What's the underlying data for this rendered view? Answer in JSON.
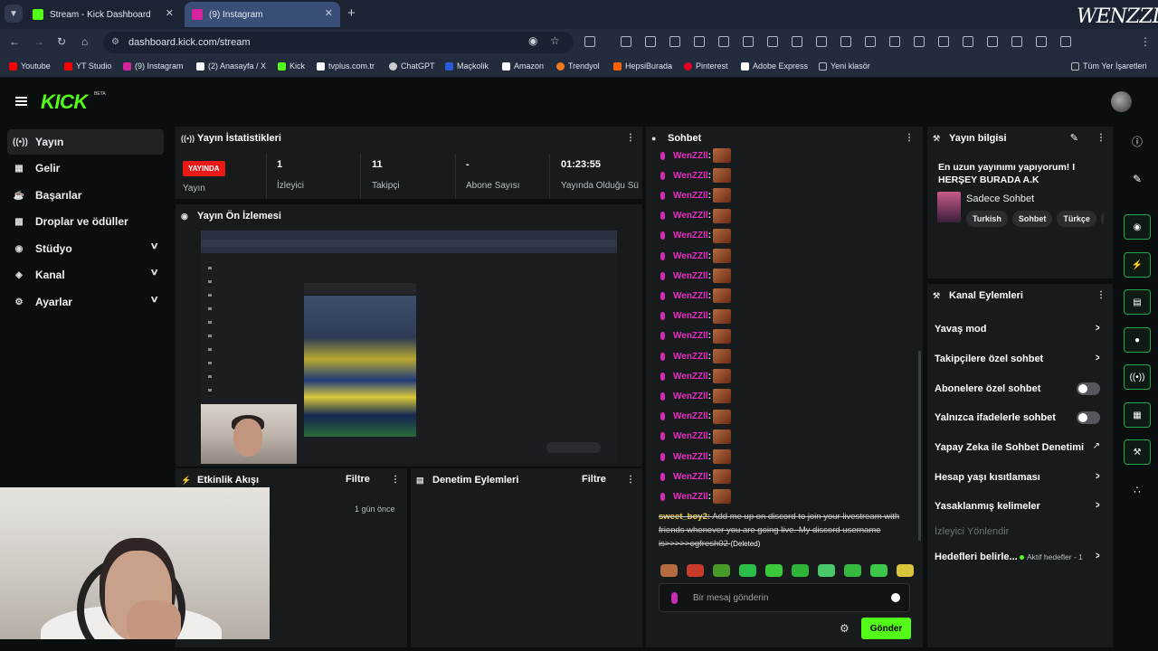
{
  "browser": {
    "tabs": [
      {
        "title": "Stream - Kick Dashboard",
        "favicon_color": "#53fc18"
      },
      {
        "title": "(9) Instagram",
        "favicon_color": "#d6249f"
      }
    ],
    "url": "dashboard.kick.com/stream",
    "bookmarks": [
      {
        "label": "Youtube",
        "color": "#ff0000"
      },
      {
        "label": "YT Studio",
        "color": "#ff0000"
      },
      {
        "label": "(9) Instagram",
        "color": "#d6249f"
      },
      {
        "label": "(2) Anasayfa / X",
        "color": "#ffffff"
      },
      {
        "label": "Kick",
        "color": "#53fc18"
      },
      {
        "label": "tvplus.com.tr",
        "color": "#ffffff"
      },
      {
        "label": "ChatGPT",
        "color": "#cccccc"
      },
      {
        "label": "Maçkolik",
        "color": "#2a5bd7"
      },
      {
        "label": "Amazon",
        "color": "#ffffff"
      },
      {
        "label": "Trendyol",
        "color": "#f27a1a"
      },
      {
        "label": "HepsiBurada",
        "color": "#ff6000"
      },
      {
        "label": "Pinterest",
        "color": "#e60023"
      },
      {
        "label": "Adobe Express",
        "color": "#ffffff"
      },
      {
        "label": "Yeni klasör",
        "color": "#bbbbbb"
      }
    ],
    "all_bookmarks": "Tüm Yer İşaretleri"
  },
  "brand": {
    "logo": "KICK",
    "beta": "BETA"
  },
  "sidebar": {
    "items": [
      {
        "label": "Yayın",
        "icon": "broadcast-icon"
      },
      {
        "label": "Gelir",
        "icon": "revenue-icon"
      },
      {
        "label": "Başarılar",
        "icon": "trophy-icon"
      },
      {
        "label": "Droplar ve ödüller",
        "icon": "gift-icon"
      },
      {
        "label": "Stüdyo",
        "icon": "eye-icon"
      },
      {
        "label": "Kanal",
        "icon": "channel-icon"
      },
      {
        "label": "Ayarlar",
        "icon": "gear-icon"
      }
    ]
  },
  "stats": {
    "title": "Yayın İstatistikleri",
    "live_badge": "YAYINDA",
    "items": [
      {
        "value": "",
        "label": "Yayın"
      },
      {
        "value": "1",
        "label": "İzleyici"
      },
      {
        "value": "11",
        "label": "Takipçi"
      },
      {
        "value": "-",
        "label": "Abone Sayısı"
      },
      {
        "value": "01:23:55",
        "label": "Yayında Olduğu Sü"
      }
    ]
  },
  "preview": {
    "title": "Yayın Ön İzlemesi"
  },
  "activity": {
    "title": "Etkinlik Akışı",
    "filter": "Filtre",
    "entry_time": "1 gün önce"
  },
  "moderation": {
    "title": "Denetim Eylemleri",
    "filter": "Filtre"
  },
  "chat": {
    "title": "Sohbet",
    "repeat_user": "WenZZll",
    "repeat_count": 18,
    "deleted": {
      "user": "sweet_boy2:",
      "text": "Add me up on discord to join your livestream with friends whenever you are going live. My discord username is>>>>>ogfresh02",
      "flag": "(Deleted)"
    },
    "input_placeholder": "Bir mesaj gönderin",
    "send": "Gönder"
  },
  "stream_info": {
    "title": "Yayın bilgisi",
    "stream_title": "En uzun yayınımı yapıyorum! I HERŞEY BURADA A.K",
    "category": "Sadece Sohbet",
    "tags": [
      "Turkish",
      "Sohbet",
      "Türkçe"
    ]
  },
  "channel_actions": {
    "title": "Kanal Eylemleri",
    "items": [
      {
        "label": "Yavaş mod",
        "control": "chevron"
      },
      {
        "label": "Takipçilere özel sohbet",
        "control": "chevron"
      },
      {
        "label": "Abonelere özel sohbet",
        "control": "toggle"
      },
      {
        "label": "Yalnızca ifadelerle sohbet",
        "control": "toggle"
      },
      {
        "label": "Yapay Zeka ile Sohbet Denetimi",
        "control": "external"
      },
      {
        "label": "Hesap yaşı kısıtlaması",
        "control": "chevron"
      },
      {
        "label": "Yasaklanmış kelimeler",
        "control": "chevron"
      },
      {
        "label": "İzleyici Yönlendir",
        "control": "none"
      },
      {
        "label": "Hedefleri belirle...",
        "control": "chevron"
      }
    ],
    "goals_badge": "Aktif hedefler - 1"
  },
  "watermark": "WENZZLL"
}
